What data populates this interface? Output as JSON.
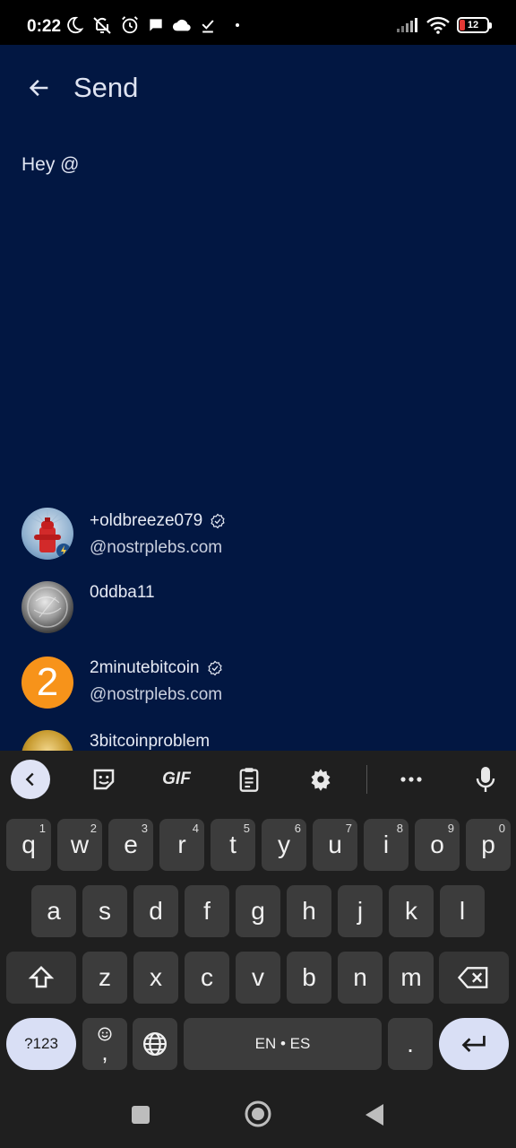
{
  "status_bar": {
    "time": "0:22",
    "battery_level": "12",
    "icons": [
      "moon-icon",
      "ringer-off-icon",
      "alarm-icon",
      "chat-icon",
      "cloud-icon",
      "download-done-icon",
      "dot-icon",
      "signal-icon",
      "wifi-icon",
      "battery-icon"
    ]
  },
  "header": {
    "back_icon": "arrow-left-icon",
    "title": "Send"
  },
  "compose": {
    "text": "Hey @"
  },
  "suggestions": [
    {
      "name": "+oldbreeze079",
      "handle": "@nostrplebs.com",
      "verified": true,
      "avatar": "hydrant-avatar"
    },
    {
      "name": "0ddba11",
      "handle": "",
      "verified": false,
      "avatar": "coin-avatar"
    },
    {
      "name": "2minutebitcoin",
      "handle": "@nostrplebs.com",
      "verified": true,
      "avatar": "number-2-avatar",
      "avatar_text": "2"
    },
    {
      "name": "3bitcoinproblem",
      "handle": "",
      "verified": false,
      "avatar": "gold-avatar"
    }
  ],
  "keyboard": {
    "toolbar": [
      "collapse-icon",
      "sticker-icon",
      "gif-icon",
      "clipboard-icon",
      "settings-icon",
      "more-icon",
      "mic-icon"
    ],
    "gif_label": "GIF",
    "row1": [
      {
        "k": "q",
        "h": "1"
      },
      {
        "k": "w",
        "h": "2"
      },
      {
        "k": "e",
        "h": "3"
      },
      {
        "k": "r",
        "h": "4"
      },
      {
        "k": "t",
        "h": "5"
      },
      {
        "k": "y",
        "h": "6"
      },
      {
        "k": "u",
        "h": "7"
      },
      {
        "k": "i",
        "h": "8"
      },
      {
        "k": "o",
        "h": "9"
      },
      {
        "k": "p",
        "h": "0"
      }
    ],
    "row2": [
      "a",
      "s",
      "d",
      "f",
      "g",
      "h",
      "j",
      "k",
      "l"
    ],
    "row3": [
      "z",
      "x",
      "c",
      "v",
      "b",
      "n",
      "m"
    ],
    "symbols_label": "?123",
    "emoji_comma": ",",
    "space_label": "EN • ES",
    "period": "."
  },
  "nav_bar": [
    "recents-icon",
    "home-icon",
    "back-icon"
  ],
  "colors": {
    "app_background": "#021742",
    "keyboard_background": "#1f1f1f",
    "key": "#3c3c3c",
    "accent_key": "#d9dff5",
    "avatar_orange": "#f7931a"
  }
}
